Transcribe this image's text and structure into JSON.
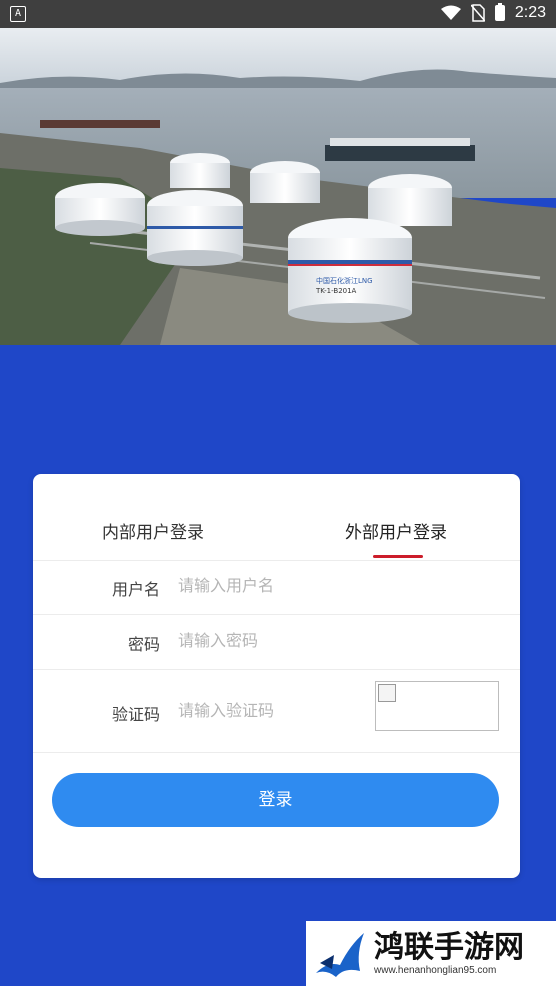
{
  "status_bar": {
    "time": "2:23",
    "left_icon": "a-notification-icon",
    "icons": [
      "wifi-icon",
      "no-sim-icon",
      "battery-charging-icon"
    ]
  },
  "hero": {
    "image": "lng-terminal-aerial-photo",
    "tank_labels": [
      "中国石化浙江LNG",
      "TK-1-B201A"
    ]
  },
  "login_card": {
    "tabs": [
      {
        "label": "内部用户登录",
        "active": false
      },
      {
        "label": "外部用户登录",
        "active": true
      }
    ],
    "fields": {
      "username": {
        "label": "用户名",
        "placeholder": "请输入用户名",
        "value": ""
      },
      "password": {
        "label": "密码",
        "placeholder": "请输入密码",
        "value": ""
      },
      "captcha": {
        "label": "验证码",
        "placeholder": "请输入验证码",
        "value": ""
      }
    },
    "submit_label": "登录"
  },
  "watermark": {
    "title": "鸿联手游网",
    "url": "www.henanhonglian95.com"
  },
  "colors": {
    "background": "#1f47c8",
    "button": "#2f8bf0",
    "active_tab_underline": "#cc1d2a",
    "status_bar": "#3f3f3f"
  }
}
